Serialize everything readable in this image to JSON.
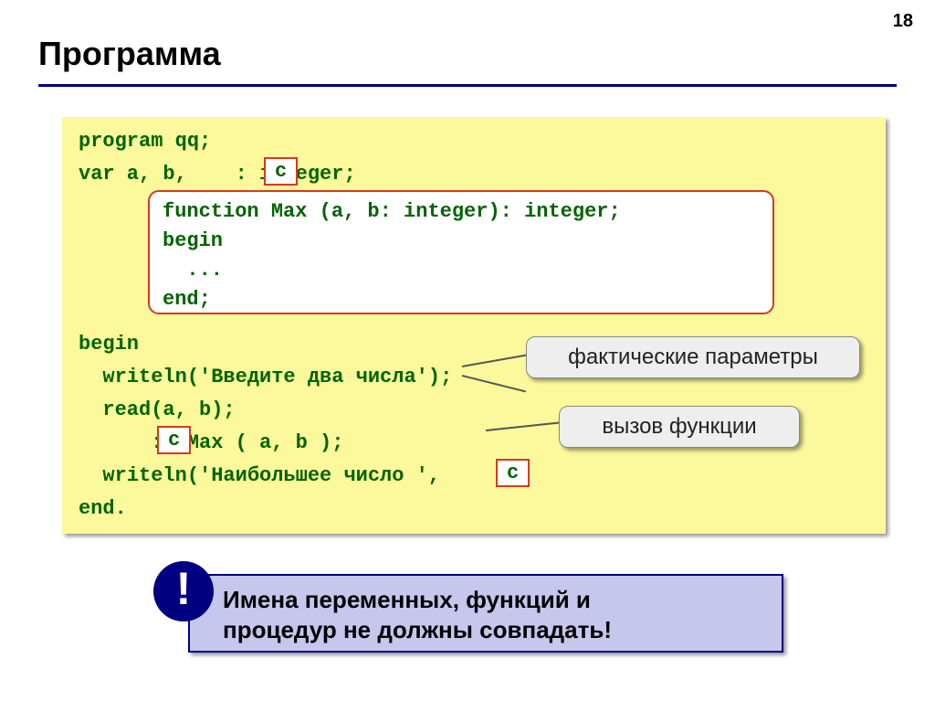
{
  "pageNumber": "18",
  "title": "Программа",
  "code": {
    "l1": "program qq;",
    "l2": "var a, b,    : integer;",
    "l3": "begin",
    "l4": "  writeln('Введите два числа');",
    "l5": "  read(a, b);",
    "l6": "      := Max ( a, b );",
    "l7": "  writeln('Наибольшее число ',     );",
    "l8": "end."
  },
  "cbox": "c",
  "funcBox": {
    "f1": "function Max (a, b: integer): integer;",
    "f2": "begin",
    "f3": "  ...",
    "f4": "end;"
  },
  "callouts": {
    "params": "фактические параметры",
    "call": "вызов функции"
  },
  "note": {
    "line1": "Имена переменных, функций и",
    "line2": "процедур не должны совпадать!"
  },
  "noteIcon": "!"
}
